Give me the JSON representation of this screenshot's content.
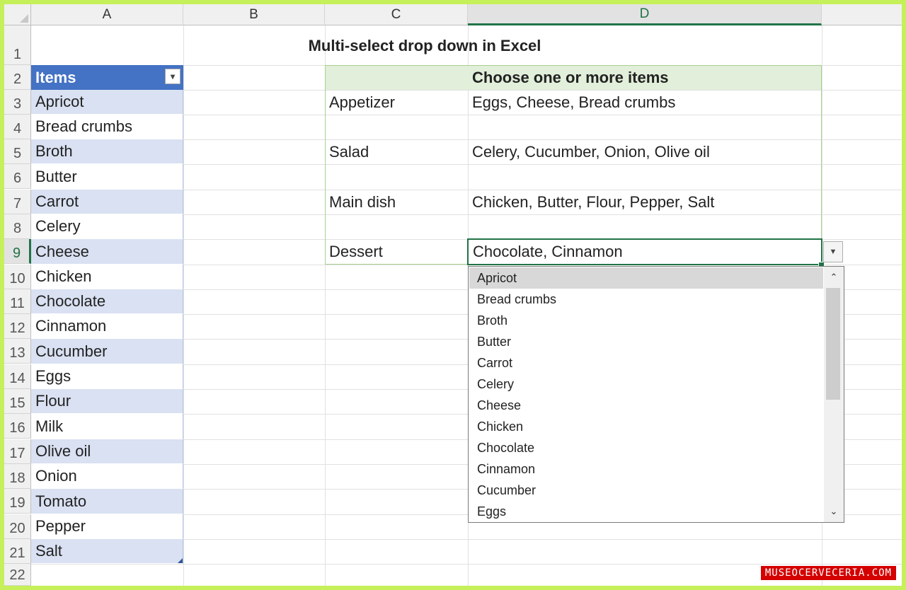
{
  "columns": [
    "A",
    "B",
    "C",
    "D"
  ],
  "rows": [
    "1",
    "2",
    "3",
    "4",
    "5",
    "6",
    "7",
    "8",
    "9",
    "10",
    "11",
    "12",
    "13",
    "14",
    "15",
    "16",
    "17",
    "18",
    "19",
    "20",
    "21",
    "22"
  ],
  "title": "Multi-select drop down in Excel",
  "items_table": {
    "header": "Items",
    "values": [
      "Apricot",
      "Bread crumbs",
      "Broth",
      "Butter",
      "Carrot",
      "Celery",
      "Cheese",
      "Chicken",
      "Chocolate",
      "Cinnamon",
      "Cucumber",
      "Eggs",
      "Flour",
      "Milk",
      "Olive oil",
      "Onion",
      "Tomato",
      "Pepper",
      "Salt"
    ]
  },
  "choices": {
    "header": "Choose one or more items",
    "rows": [
      {
        "label": "Appetizer",
        "value": "Eggs, Cheese, Bread crumbs"
      },
      {
        "label": "Salad",
        "value": "Celery, Cucumber, Onion, Olive oil"
      },
      {
        "label": "Main dish",
        "value": "Chicken, Butter, Flour, Pepper, Salt"
      },
      {
        "label": "Dessert",
        "value": "Chocolate, Cinnamon"
      }
    ]
  },
  "dropdown": {
    "highlighted": "Apricot",
    "options": [
      "Apricot",
      "Bread crumbs",
      "Broth",
      "Butter",
      "Carrot",
      "Celery",
      "Cheese",
      "Chicken",
      "Chocolate",
      "Cinnamon",
      "Cucumber",
      "Eggs"
    ]
  },
  "icons": {
    "filter": "filter-dropdown-icon",
    "dropdown_arrow": "chevron-down-icon",
    "scroll_up": "chevron-up-icon",
    "scroll_down": "chevron-down-icon"
  },
  "colors": {
    "table_header": "#4472c4",
    "band": "#d9e1f2",
    "choice_header": "#e2efda",
    "selection": "#217346",
    "frame": "#c6f05a"
  },
  "watermark": "MUSEOCERVECERIA.COM"
}
